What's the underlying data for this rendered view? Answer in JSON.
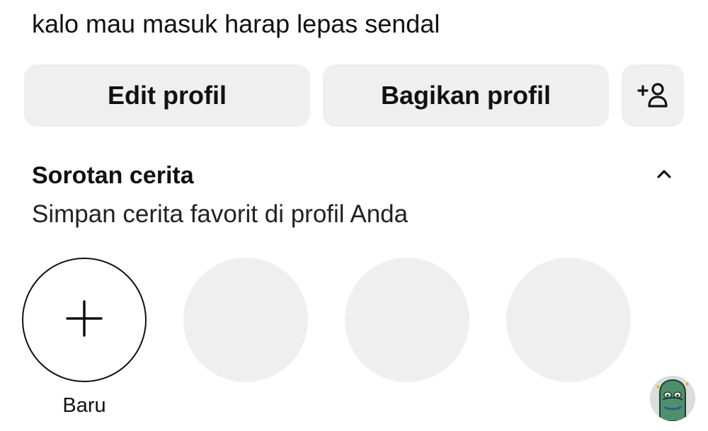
{
  "profile": {
    "bio": "kalo mau masuk harap lepas sendal"
  },
  "actions": {
    "edit_label": "Edit profil",
    "share_label": "Bagikan profil",
    "add_person_icon": "add-person-icon"
  },
  "highlights": {
    "title": "Sorotan cerita",
    "subtitle": "Simpan cerita favorit di profil Anda",
    "new_label": "Baru",
    "placeholder_count": 3,
    "collapse_icon": "chevron-up-icon"
  },
  "colors": {
    "button_bg": "#efefef",
    "placeholder_bg": "#efefef",
    "text": "#111111"
  }
}
